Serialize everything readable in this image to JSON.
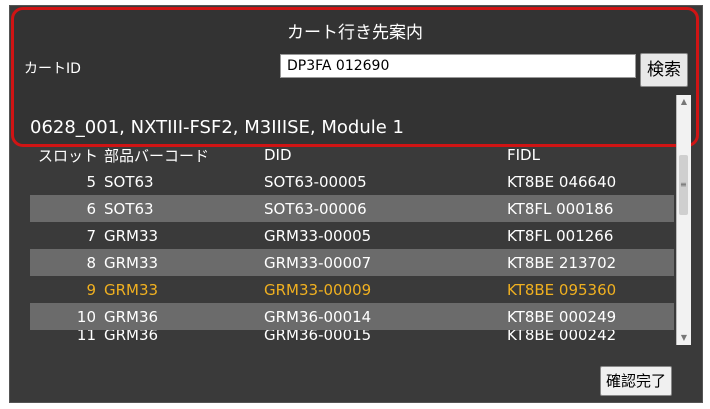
{
  "header": {
    "title": "カート行き先案内",
    "cart_id_label": "カートID",
    "cart_id_value": "DP3FA 012690",
    "search_label": "検索",
    "module_text": "0628_001, NXTIII-FSF2, M3IIISE, Module 1"
  },
  "table": {
    "columns": [
      "スロット",
      "部品バーコード",
      "DID",
      "FIDL"
    ],
    "rows": [
      {
        "slot": "5",
        "part": "SOT63",
        "did": "SOT63-00005",
        "fidl": "KT8BE 046640"
      },
      {
        "slot": "6",
        "part": "SOT63",
        "did": "SOT63-00006",
        "fidl": "KT8FL 000186"
      },
      {
        "slot": "7",
        "part": "GRM33",
        "did": "GRM33-00005",
        "fidl": "KT8FL 001266"
      },
      {
        "slot": "8",
        "part": "GRM33",
        "did": "GRM33-00007",
        "fidl": "KT8BE 213702"
      },
      {
        "slot": "9",
        "part": "GRM33",
        "did": "GRM33-00009",
        "fidl": "KT8BE 095360"
      },
      {
        "slot": "10",
        "part": "GRM36",
        "did": "GRM36-00014",
        "fidl": "KT8BE 000249"
      },
      {
        "slot": "11",
        "part": "GRM36",
        "did": "GRM36-00015",
        "fidl": "KT8BE 000242"
      }
    ],
    "highlight_color": "#f0b020"
  },
  "footer": {
    "confirm_label": "確認完了"
  },
  "colors": {
    "frame_border": "#d01414",
    "background": "#333333",
    "alt_row": "#6b6b6b"
  }
}
